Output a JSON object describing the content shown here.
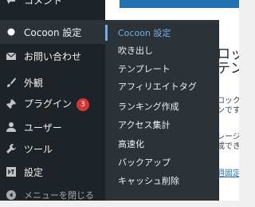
{
  "sidebar": {
    "items": [
      {
        "label": "コメント",
        "icon": "comment-icon"
      },
      {
        "label": "Cocoon 設定",
        "icon": "circle-icon"
      },
      {
        "label": "お問い合わせ",
        "icon": "mail-icon"
      },
      {
        "label": "外観",
        "icon": "paintbrush-icon"
      },
      {
        "label": "プラグイン",
        "icon": "plugin-icon",
        "badge": "3"
      },
      {
        "label": "ユーザー",
        "icon": "user-icon"
      },
      {
        "label": "ツール",
        "icon": "wrench-icon"
      },
      {
        "label": "設定",
        "icon": "settings-icon"
      },
      {
        "label": "メニューを閉じる",
        "icon": "collapse-icon"
      }
    ]
  },
  "flyout": {
    "items": [
      {
        "label": "Cocoon 設定",
        "active": true
      },
      {
        "label": "吹き出し"
      },
      {
        "label": "テンプレート"
      },
      {
        "label": "アフィリエイトタグ"
      },
      {
        "label": "ランキング作成"
      },
      {
        "label": "アクセス集計"
      },
      {
        "label": "高速化"
      },
      {
        "label": "バックアップ"
      },
      {
        "label": "キャッシュ削除"
      }
    ]
  },
  "content": {
    "heading_line1": "ロッ",
    "heading_line2": "テン",
    "body_lines": [
      "ロックバ",
      "ンです。",
      "レージ",
      "成できま"
    ],
    "link": "週固定ペ"
  },
  "colors": {
    "sidebar_bg": "#1d2327",
    "flyout_bg": "#2c3338",
    "accent": "#72aee6",
    "badge": "#d63638",
    "content_blue": "#2271b1"
  }
}
